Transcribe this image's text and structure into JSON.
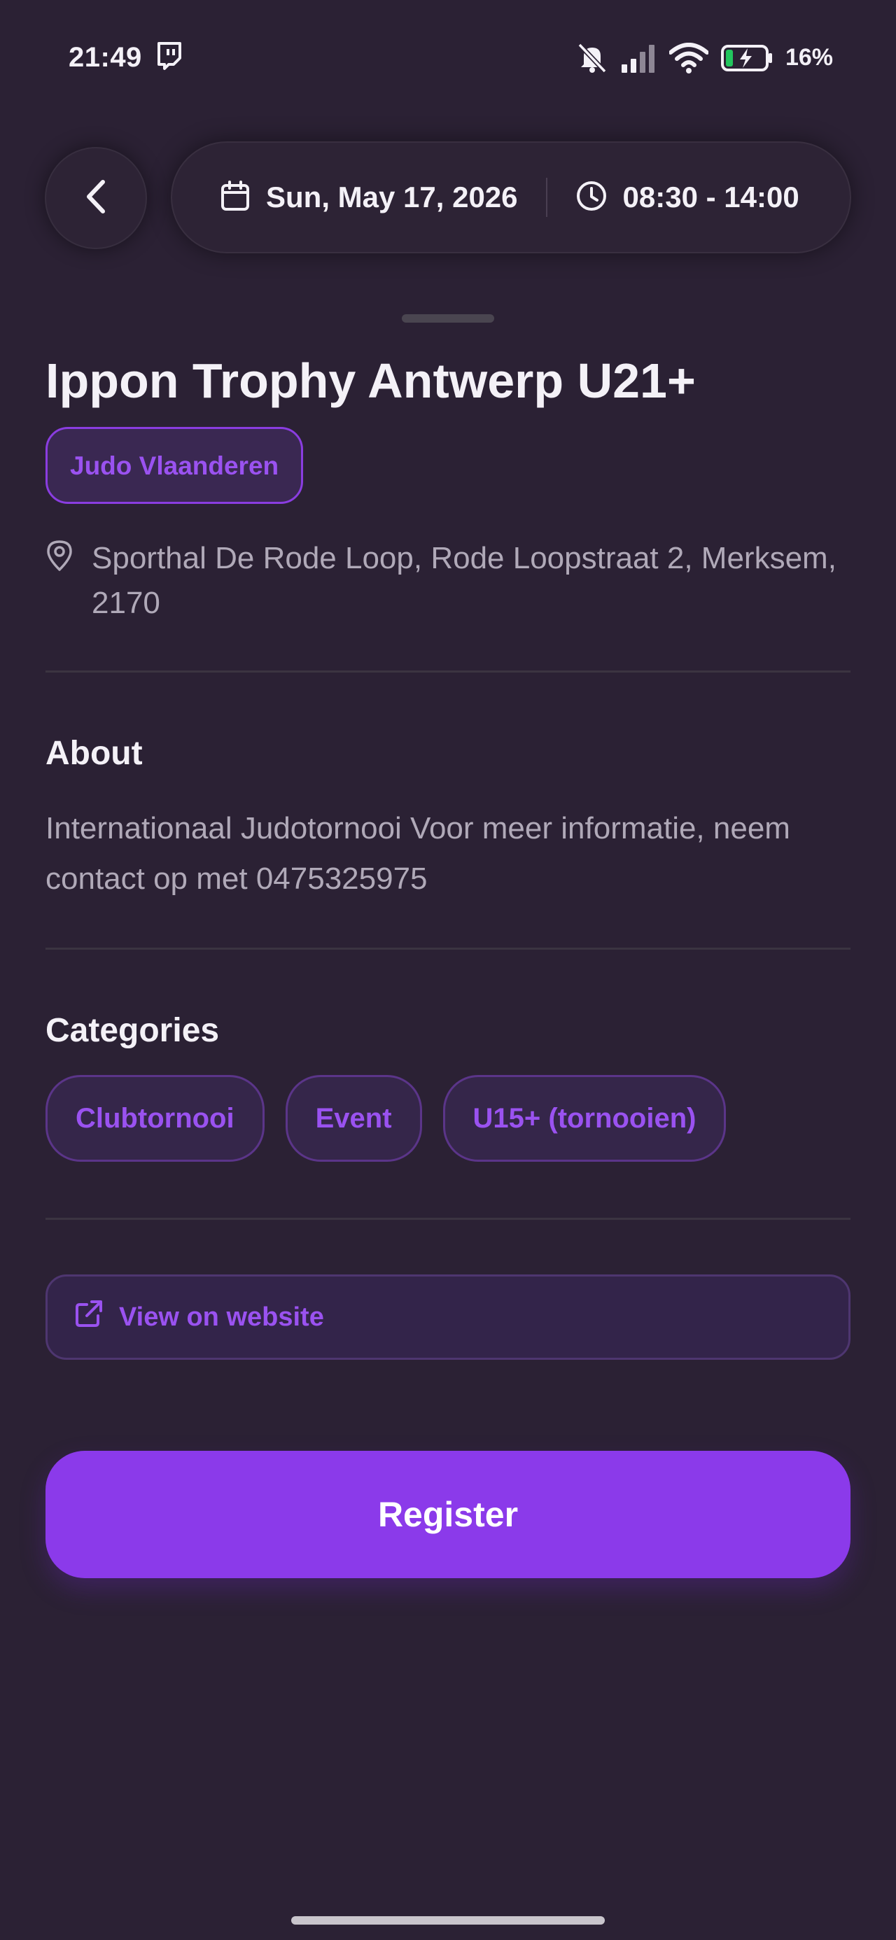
{
  "status_bar": {
    "time": "21:49",
    "battery": "16%",
    "icons": [
      "twitch-icon",
      "bell-off-icon",
      "signal-icon",
      "wifi-icon",
      "battery-charging-icon"
    ]
  },
  "header": {
    "back_icon": "chevron-left-icon",
    "date": "Sun, May 17, 2026",
    "time_range": "08:30 - 14:00"
  },
  "event": {
    "title": "Ippon Trophy Antwerp U21+",
    "organizer": "Judo Vlaanderen",
    "location": "Sporthal De Rode Loop, Rode Loopstraat 2, Merksem, 2170"
  },
  "about": {
    "heading": "About",
    "text": "Internationaal Judotornooi Voor meer informatie, neem contact op met  0475325975"
  },
  "categories": {
    "heading": "Categories",
    "items": [
      "Clubtornooi",
      "Event",
      "U15+ (tornooien)"
    ]
  },
  "actions": {
    "website_label": "View on website",
    "register_label": "Register"
  },
  "colors": {
    "background": "#2b2134",
    "accent": "#8b3aea",
    "accent_text": "#9a52f0"
  }
}
